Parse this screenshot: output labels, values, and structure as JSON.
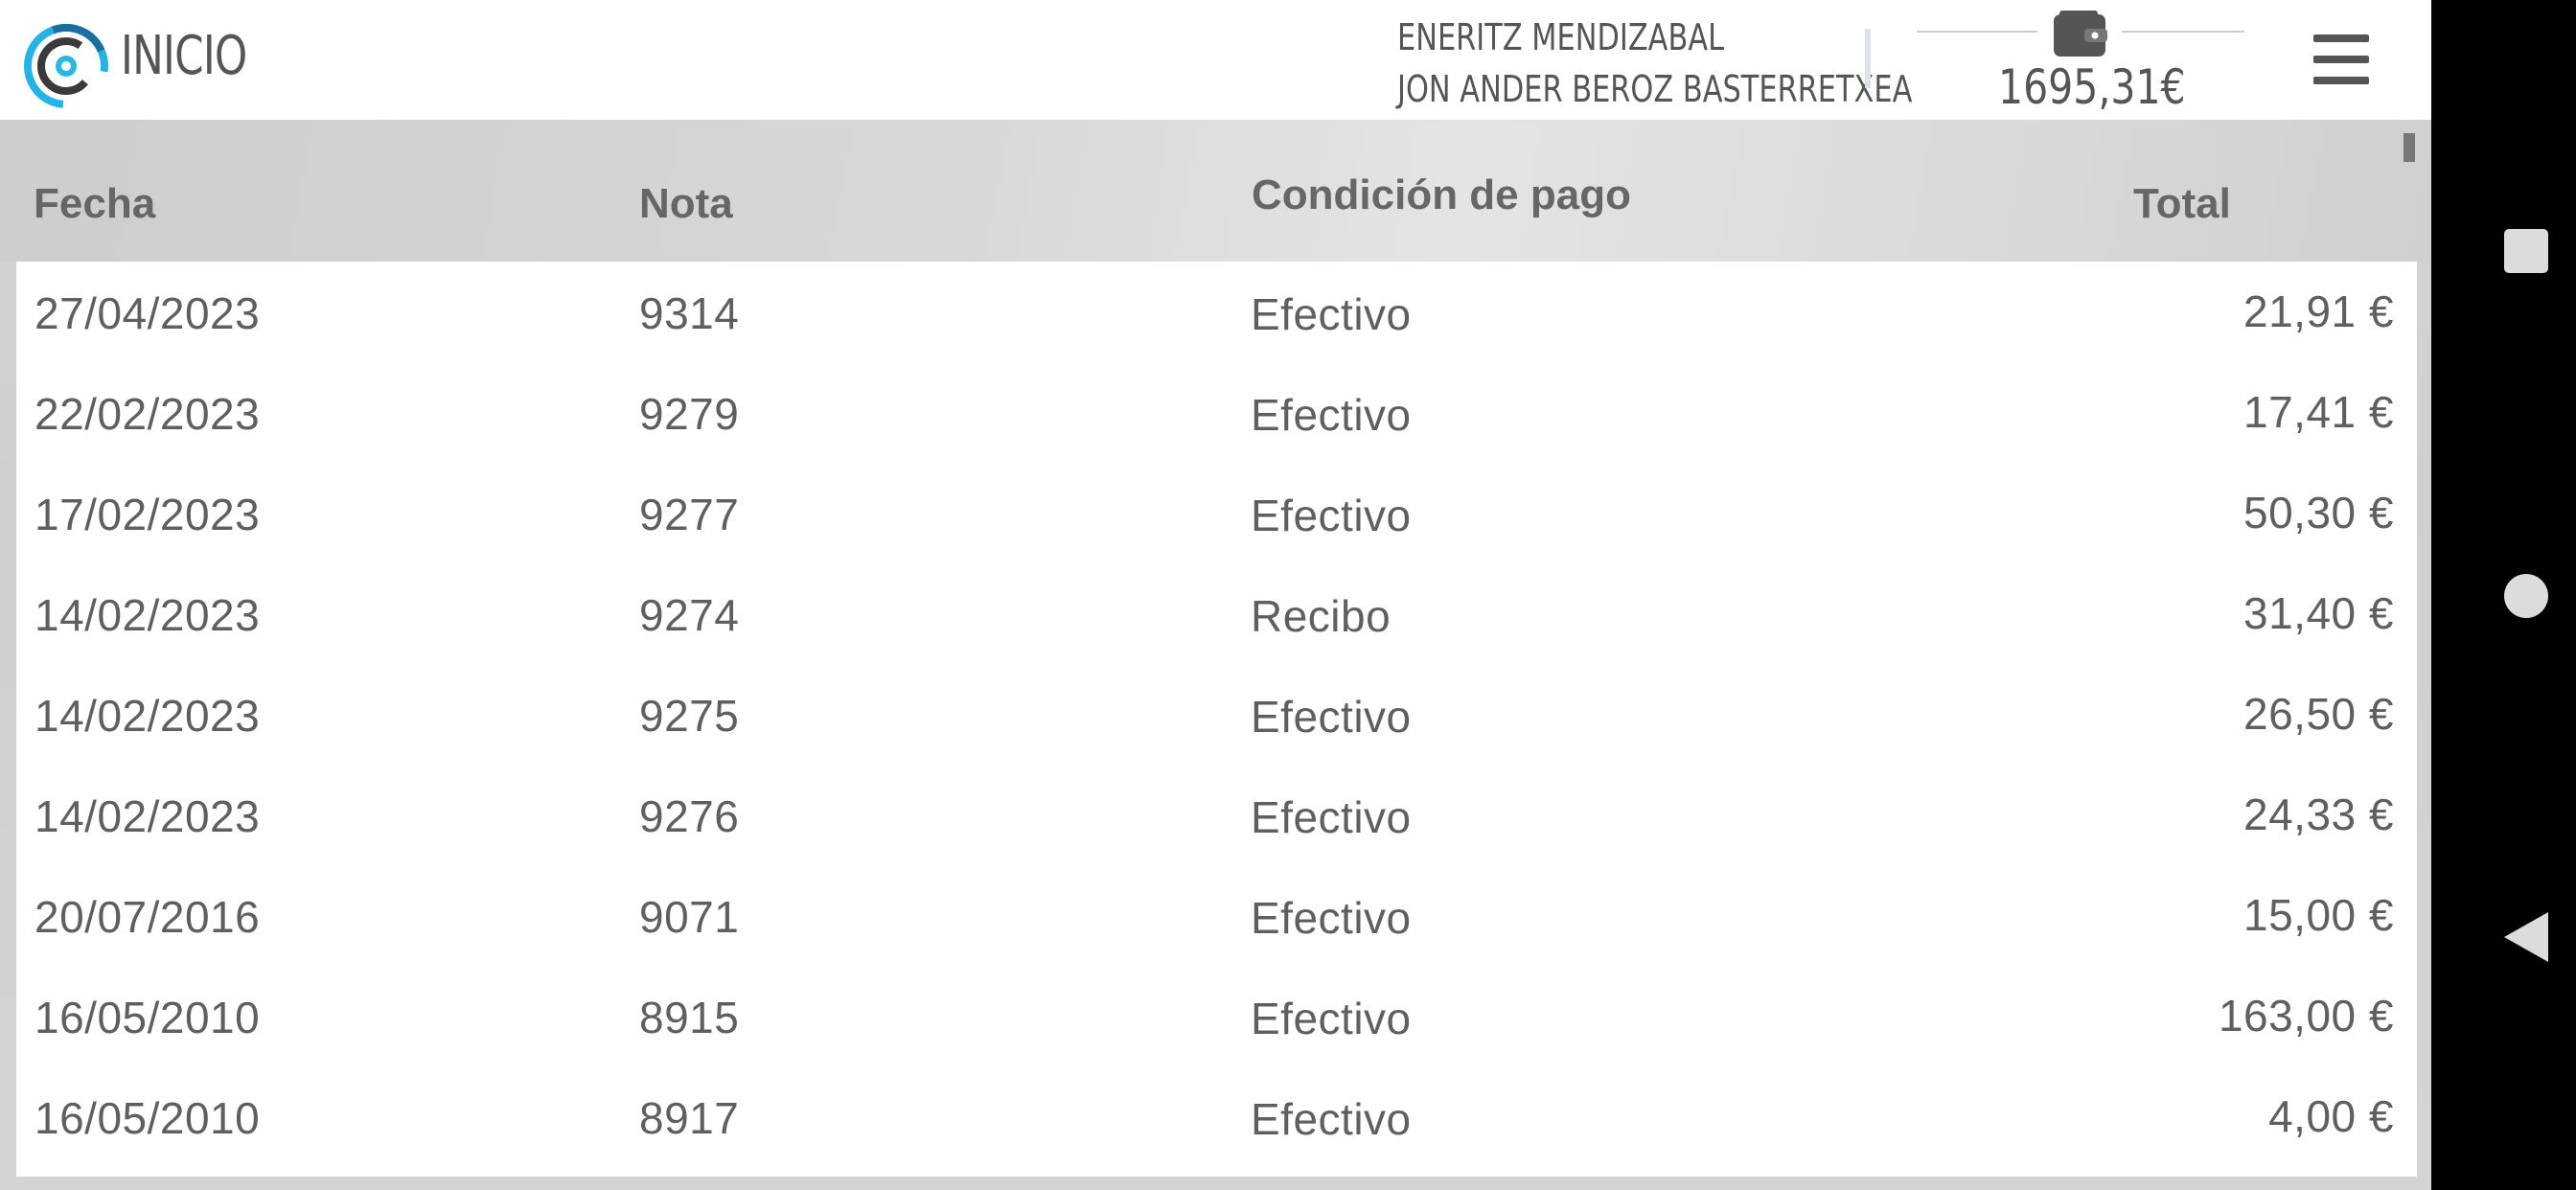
{
  "header": {
    "home_label": "INICIO",
    "user_1": "ENERITZ MENDIZABAL",
    "user_2": "JON ANDER BEROZ BASTERRETXEA",
    "balance": "1695,31€",
    "wallet_icon": "wallet-icon",
    "menu_icon": "hamburger-menu-icon"
  },
  "table": {
    "headers": {
      "fecha": "Fecha",
      "nota": "Nota",
      "condicion": "Condición de pago",
      "total": "Total"
    },
    "rows": [
      {
        "fecha": "27/04/2023",
        "nota": "9314",
        "condicion": "Efectivo",
        "total": "21,91 €"
      },
      {
        "fecha": "22/02/2023",
        "nota": "9279",
        "condicion": "Efectivo",
        "total": "17,41 €"
      },
      {
        "fecha": "17/02/2023",
        "nota": "9277",
        "condicion": "Efectivo",
        "total": "50,30 €"
      },
      {
        "fecha": "14/02/2023",
        "nota": "9274",
        "condicion": "Recibo",
        "total": "31,40 €"
      },
      {
        "fecha": "14/02/2023",
        "nota": "9275",
        "condicion": "Efectivo",
        "total": "26,50 €"
      },
      {
        "fecha": "14/02/2023",
        "nota": "9276",
        "condicion": "Efectivo",
        "total": "24,33 €"
      },
      {
        "fecha": "20/07/2016",
        "nota": "9071",
        "condicion": "Efectivo",
        "total": "15,00 €"
      },
      {
        "fecha": "16/05/2010",
        "nota": "8915",
        "condicion": "Efectivo",
        "total": "163,00 €"
      },
      {
        "fecha": "16/05/2010",
        "nota": "8917",
        "condicion": "Efectivo",
        "total": "4,00 €"
      }
    ]
  },
  "colors": {
    "accent": "#1ea3d6",
    "text": "#5f5f5f",
    "header_text": "#555555"
  },
  "system_nav": {
    "recents_icon": "recents-square-icon",
    "home_icon": "home-circle-icon",
    "back_icon": "back-triangle-icon"
  }
}
